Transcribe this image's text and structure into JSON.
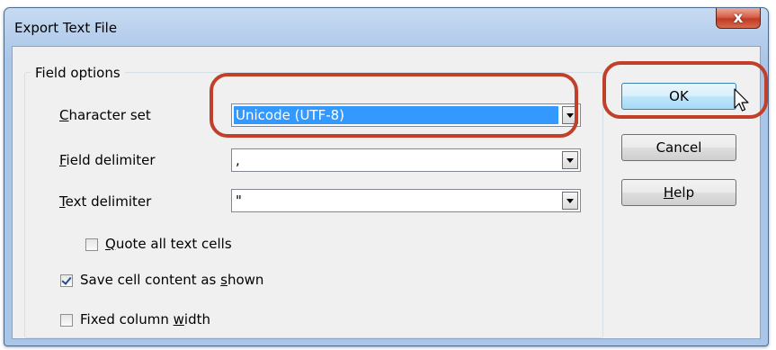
{
  "window": {
    "title": "Export Text File",
    "close_glyph": "x"
  },
  "field_options": {
    "group_label": "Field options",
    "character_set": {
      "label_u": "C",
      "label_rest": "haracter set",
      "value": "Unicode (UTF-8)"
    },
    "field_delimiter": {
      "label_u": "F",
      "label_rest": "ield delimiter",
      "value": ","
    },
    "text_delimiter": {
      "label_u": "T",
      "label_rest": "ext delimiter",
      "value": "\""
    },
    "quote_all": {
      "label_u": "Q",
      "label_rest": "uote all text cells",
      "checked": false
    },
    "save_as_shown": {
      "label_pre": "Save cell content as ",
      "label_u": "s",
      "label_post": "hown",
      "checked": true
    },
    "fixed_width": {
      "label_pre": "Fixed column ",
      "label_u": "w",
      "label_post": "idth",
      "checked": false
    }
  },
  "buttons": {
    "ok": "OK",
    "cancel": "Cancel",
    "help_u": "H",
    "help_rest": "elp"
  },
  "colors": {
    "highlight": "#3399ff",
    "annotation_ring": "#c0402a"
  }
}
